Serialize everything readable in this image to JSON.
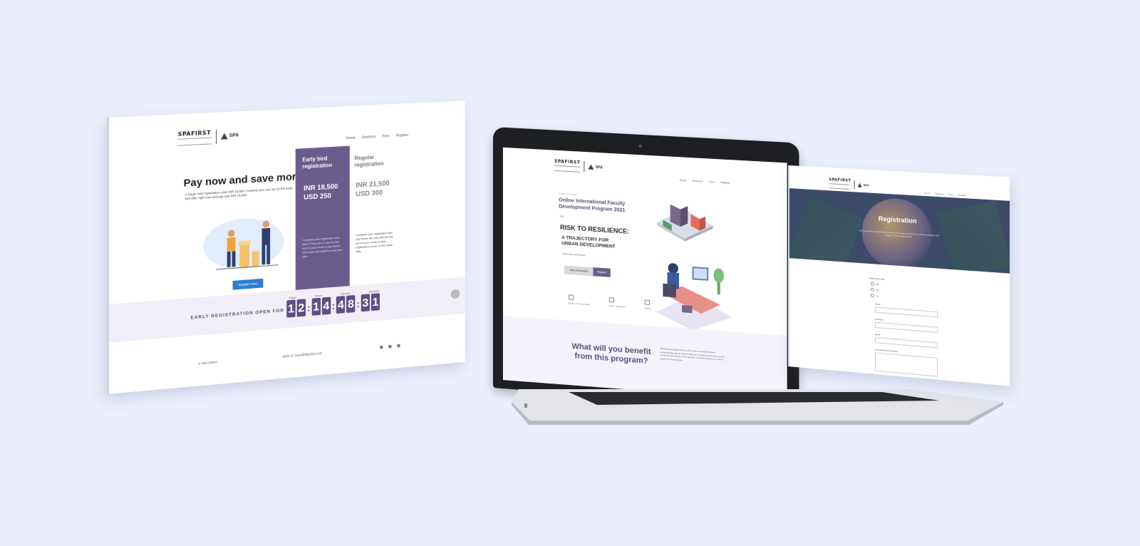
{
  "left_page": {
    "logo": "SPAFIRST",
    "spa_mark": "SPA",
    "nav": [
      "Home",
      "Sessions",
      "Fees",
      "Register"
    ],
    "title": "Pay now and save more",
    "description": "A single seat registration costs INR 21,500. However you can opt for the early bird offer right now and pay only INR 18,500.",
    "register_button": "Register Now",
    "early_card": {
      "heading": "Early bird registration",
      "price_inr": "INR 18,500",
      "price_usd": "USD 250",
      "note": "Complete your registration and select 'Pay now' or use the link sent to your email to pay before 20th June and avail the early bird offer."
    },
    "regular_card": {
      "heading": "Regular registration",
      "price_inr": "INR 21,500",
      "price_usd": "USD 300",
      "note": "Complete your registration and pay before 5th July with the link sent to your email or New registrations close on the same date."
    },
    "countdown": {
      "label": "EARLY REGISTRATION OPEN FOR",
      "units": [
        "Days",
        "Hours",
        "Minutes",
        "Seconds"
      ],
      "digits": [
        "1",
        "2",
        "1",
        "4",
        "4",
        "8",
        "3",
        "1"
      ]
    },
    "footer": {
      "copyright": "© SPA FIRST",
      "write": "Write to: team@fdp2021.com"
    }
  },
  "laptop_page": {
    "logo": "SPAFIRST",
    "spa_mark": "SPA",
    "nav": [
      "Home",
      "Sessions",
      "Fees",
      "Register"
    ],
    "kicker": "Registrations open",
    "program": "Online International Faculty Development Program 2021",
    "on": "On",
    "risk": "RISK TO RESILIENCE:",
    "trajectory": "A TRAJECTORY FOR URBAN DEVELOPMENT",
    "built": "Built form & Beyond",
    "btn_view": "View Information",
    "btn_register": "Register",
    "meta": [
      "12th to 17th July 2021",
      "10:00 - 13:00 IST",
      "Online"
    ],
    "benefit_title": "What will you benefit from this program?",
    "benefit_desc": "The faculty program will not only help to develop a better understanding about risk & resilience in cities but also give you an insight into the trends of the globally renowned experts on how to tackle the issues faced."
  },
  "right_page": {
    "logo": "SPAFIRST",
    "spa_mark": "SPA",
    "nav": [
      "Home",
      "Sessions",
      "Fees",
      "Register"
    ],
    "title": "Registration",
    "subtitle": "Every academic and professional working in the urban sector will find something valuable in this program. Please register below.",
    "form": {
      "type_label": "Registration Type",
      "options": [
        "Mr.",
        "Ms.",
        "Dr."
      ],
      "fields": [
        "Name",
        "Institution",
        "Email",
        "Correspondence Address"
      ]
    }
  },
  "colors": {
    "background": "#ebeffc",
    "accent_purple": "#6a5d8e",
    "button_blue": "#2d7fcf"
  }
}
